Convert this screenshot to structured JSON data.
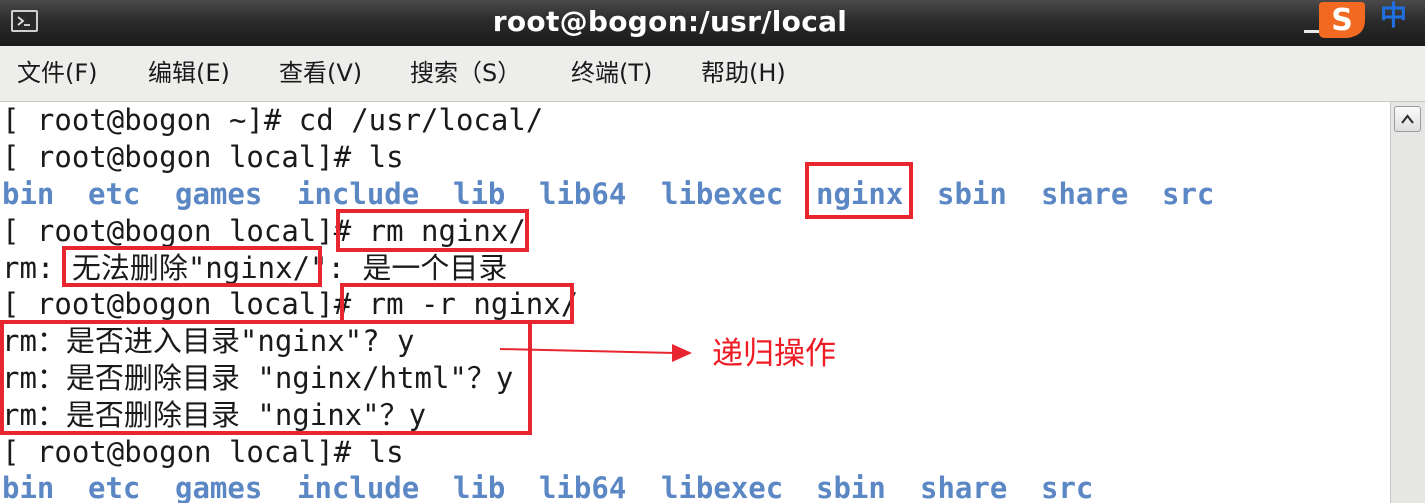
{
  "window": {
    "title": "root@bogon:/usr/local",
    "ime_zh_label": "中"
  },
  "menu": [
    {
      "label": "文件(F)"
    },
    {
      "label": "编辑(E)"
    },
    {
      "label": "查看(V)"
    },
    {
      "label": "搜索（S）"
    },
    {
      "label": "终端(T)"
    },
    {
      "label": "帮助(H)"
    }
  ],
  "terminal": {
    "lines": [
      "[ root@bogon ~]# cd /usr/local/",
      "[ root@bogon local]# ls",
      "",
      "[ root@bogon local]# rm nginx/",
      "rm: 无法删除\"nginx/\": 是一个目录",
      "[ root@bogon local]# rm -r nginx/",
      "rm：是否进入目录\"nginx\"? y",
      "rm：是否删除目录 \"nginx/html\"？y",
      "rm：是否删除目录 \"nginx\"？y",
      "[ root@bogon local]# ls",
      ""
    ],
    "ls_output": [
      "bin",
      "etc",
      "games",
      "include",
      "lib",
      "lib64",
      "libexec",
      "nginx",
      "sbin",
      "share",
      "src"
    ],
    "ls_output_after": [
      "bin",
      "etc",
      "games",
      "include",
      "lib",
      "lib64",
      "libexec",
      "sbin",
      "share",
      "src"
    ]
  },
  "annotation": {
    "note": "递归操作",
    "color": "#e8262f"
  },
  "colors": {
    "titlebar": "#2b2b2b",
    "menubar": "#ededeb",
    "directory_listing": "#5b87c4"
  }
}
